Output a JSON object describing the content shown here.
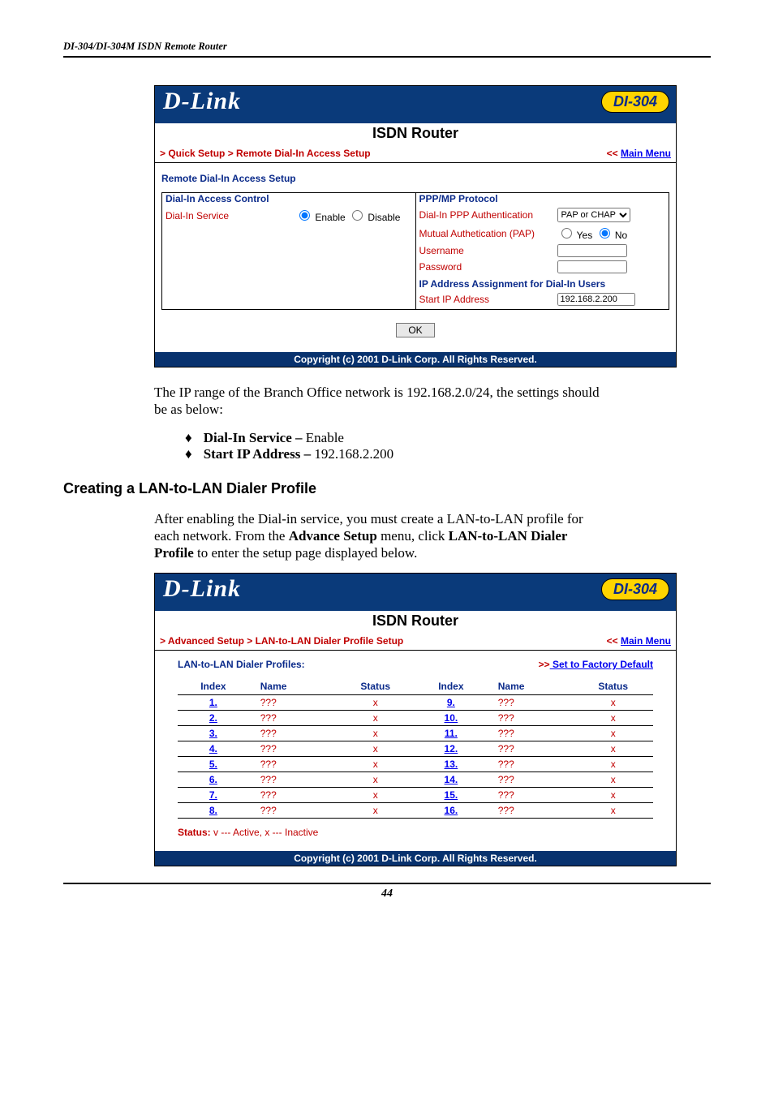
{
  "running_head": "DI-304/DI-304M ISDN Remote Router",
  "page_number": "44",
  "panel1": {
    "logo": "D-Link",
    "title": "ISDN Router",
    "model": "DI-304",
    "breadcrumb": "> Quick Setup > Remote Dial-In Access Setup",
    "main_menu_chev": "<<",
    "main_menu": "Main Menu",
    "section_title": "Remote Dial-In Access Setup",
    "left_title": "Dial-In Access Control",
    "dial_in_label": "Dial-In Service",
    "enable": "Enable",
    "disable": "Disable",
    "right_title": "PPP/MP Protocol",
    "ppp_auth_label": "Dial-In PPP Authentication",
    "ppp_auth_value": "PAP or CHAP",
    "mutual_label": "Mutual Authetication (PAP)",
    "yes": "Yes",
    "no": "No",
    "username_label": "Username",
    "username_value": "",
    "password_label": "Password",
    "password_value": "",
    "ip_section": "IP Address Assignment for Dial-In Users",
    "start_ip_label": "Start IP Address",
    "start_ip_value": "192.168.2.200",
    "ok": "OK",
    "copyright": "Copyright (c) 2001 D-Link Corp. All Rights Reserved."
  },
  "para1": "The IP range of the Branch Office network is 192.168.2.0/24, the settings should be as below:",
  "bullets": [
    {
      "b": "Dial-In Service – ",
      "t": "Enable"
    },
    {
      "b": "Start IP Address – ",
      "t": "192.168.2.200"
    }
  ],
  "heading2": "Creating a LAN-to-LAN Dialer Profile",
  "para2_a": "After enabling the Dial-in service, you must create a LAN-to-LAN profile for each network. From the ",
  "para2_b": "Advance Setup",
  "para2_c": " menu, click ",
  "para2_d": "LAN-to-LAN Dialer Profile",
  "para2_e": " to enter the setup page displayed below.",
  "panel2": {
    "logo": "D-Link",
    "title": "ISDN Router",
    "model": "DI-304",
    "breadcrumb": "> Advanced Setup > LAN-to-LAN Dialer Profile Setup",
    "main_menu_chev": "<<",
    "main_menu": "Main Menu",
    "profiles_label": "LAN-to-LAN Dialer Profiles:",
    "factory_chev": ">>",
    "factory": " Set to Factory Default",
    "th_index": "Index",
    "th_name": "Name",
    "th_status": "Status",
    "rows_left": [
      {
        "idx": "1.",
        "name": "???",
        "stat": "x"
      },
      {
        "idx": "2.",
        "name": "???",
        "stat": "x"
      },
      {
        "idx": "3.",
        "name": "???",
        "stat": "x"
      },
      {
        "idx": "4.",
        "name": "???",
        "stat": "x"
      },
      {
        "idx": "5.",
        "name": "???",
        "stat": "x"
      },
      {
        "idx": "6.",
        "name": "???",
        "stat": "x"
      },
      {
        "idx": "7.",
        "name": "???",
        "stat": "x"
      },
      {
        "idx": "8.",
        "name": "???",
        "stat": "x"
      }
    ],
    "rows_right": [
      {
        "idx": "9.",
        "name": "???",
        "stat": "x"
      },
      {
        "idx": "10.",
        "name": "???",
        "stat": "x"
      },
      {
        "idx": "11.",
        "name": "???",
        "stat": "x"
      },
      {
        "idx": "12.",
        "name": "???",
        "stat": "x"
      },
      {
        "idx": "13.",
        "name": "???",
        "stat": "x"
      },
      {
        "idx": "14.",
        "name": "???",
        "stat": "x"
      },
      {
        "idx": "15.",
        "name": "???",
        "stat": "x"
      },
      {
        "idx": "16.",
        "name": "???",
        "stat": "x"
      }
    ],
    "status_legend_b": "Status:",
    "status_legend_t": " v --- Active, x --- Inactive",
    "copyright": "Copyright (c) 2001 D-Link Corp. All Rights Reserved."
  }
}
